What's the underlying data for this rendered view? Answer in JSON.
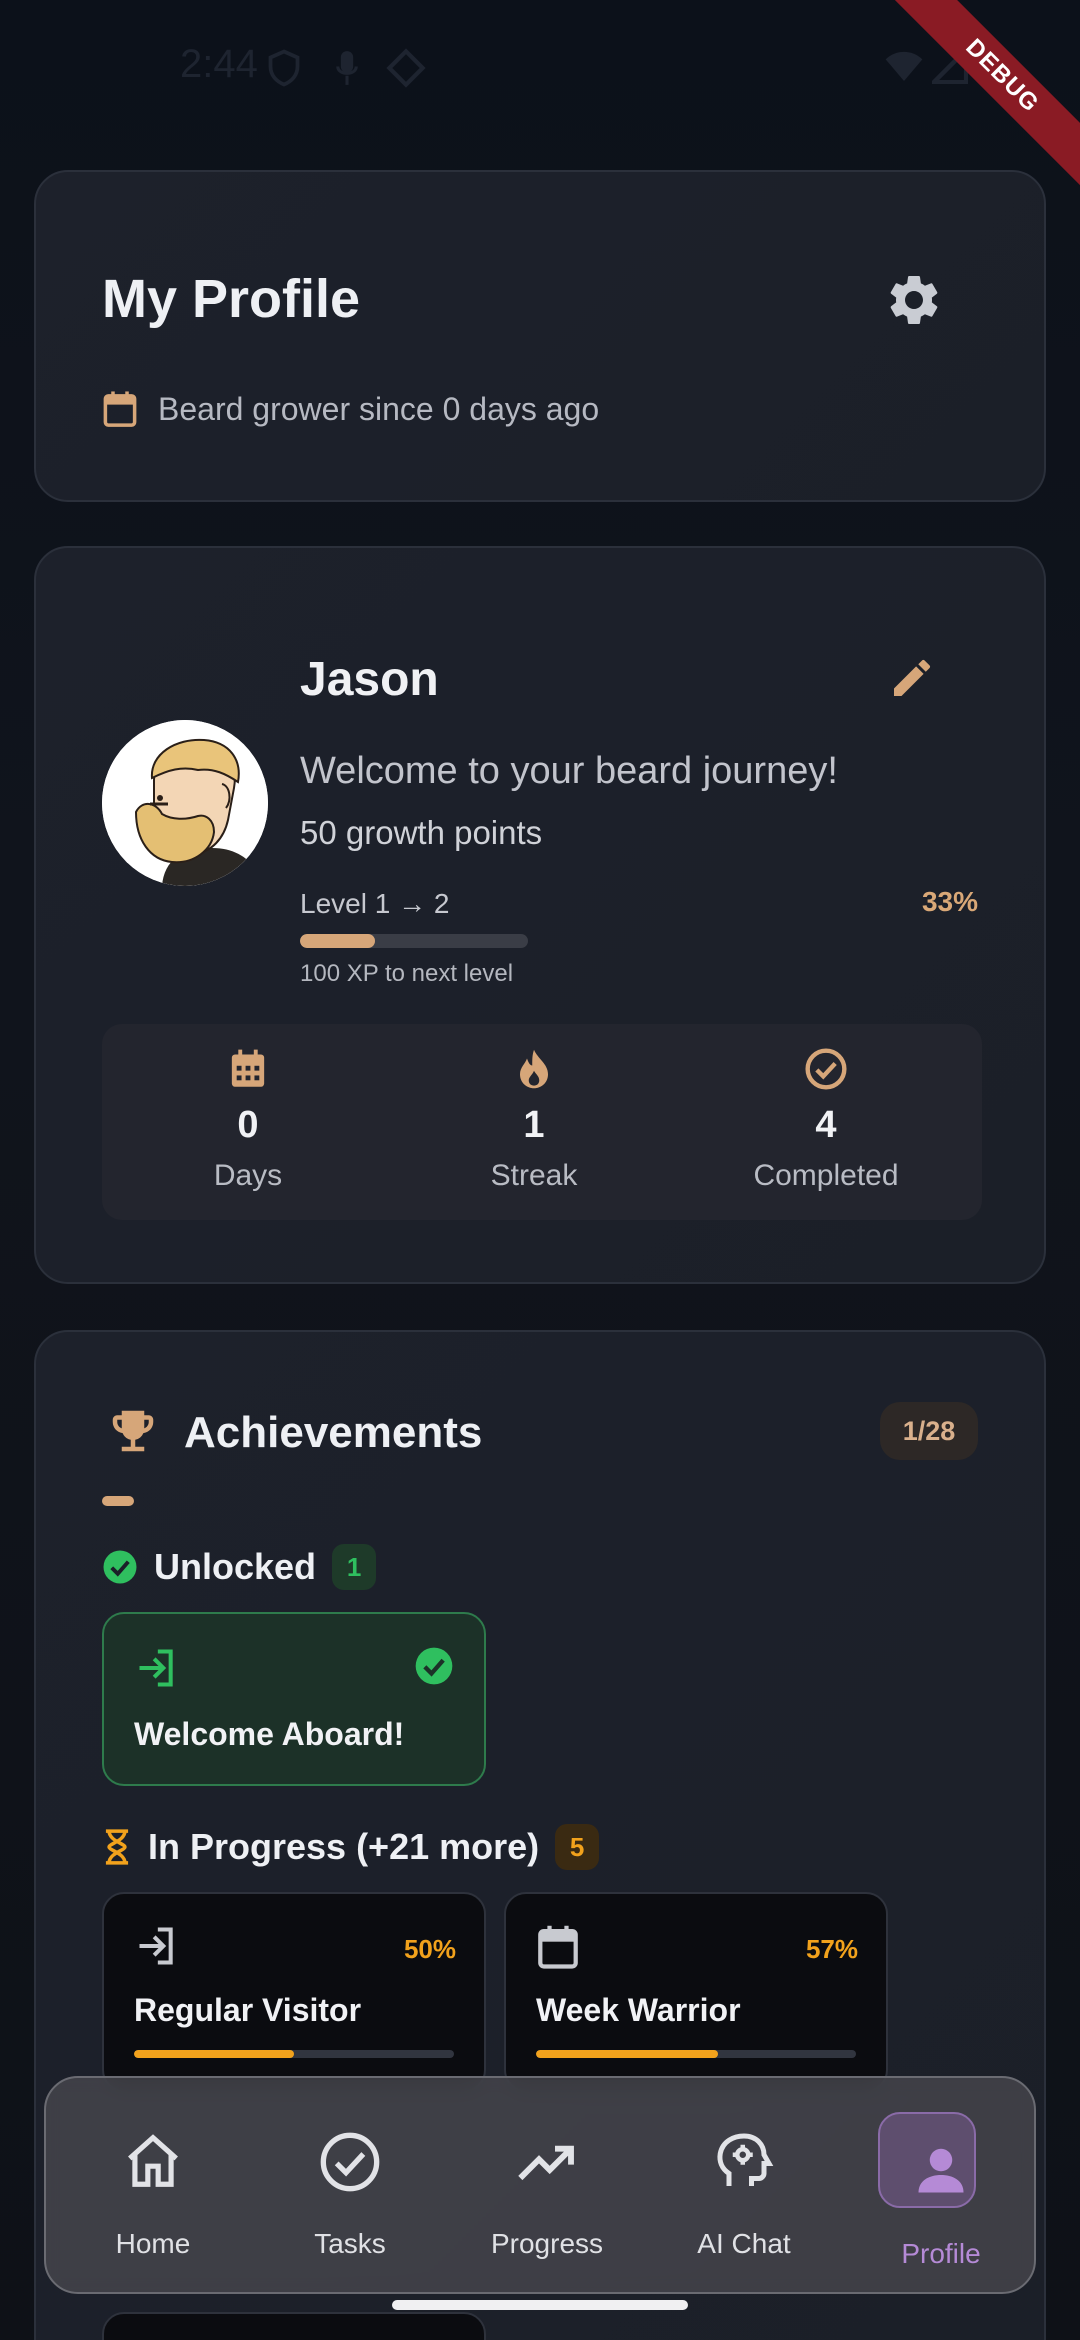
{
  "status_bar": {
    "time": "2:44",
    "debug_label": "DEBUG"
  },
  "profile_header": {
    "title": "My Profile",
    "since_text": "Beard grower since 0 days ago",
    "icons": {
      "settings": "gear-icon",
      "calendar": "calendar-icon"
    }
  },
  "user": {
    "name": "Jason",
    "welcome": "Welcome to your beard journey!",
    "points": "50 growth points",
    "level_text": "Level 1 → 2",
    "level_percent": "33%",
    "xp_progress": 0.33,
    "xp_next": "100 XP to next level",
    "stats": [
      {
        "icon": "calendar-grid-icon",
        "value": "0",
        "label": "Days"
      },
      {
        "icon": "flame-icon",
        "value": "1",
        "label": "Streak"
      },
      {
        "icon": "check-circle-icon",
        "value": "4",
        "label": "Completed"
      }
    ]
  },
  "achievements": {
    "title": "Achievements",
    "count": "1/28",
    "unlocked": {
      "label": "Unlocked",
      "count": "1",
      "items": [
        {
          "name": "Welcome Aboard!",
          "icon": "login-icon"
        }
      ]
    },
    "in_progress": {
      "label": "In Progress (+21 more)",
      "count": "5",
      "items": [
        {
          "name": "Regular Visitor",
          "percent": "50%",
          "progress": 0.5,
          "icon": "login-icon"
        },
        {
          "name": "Week Warrior",
          "percent": "57%",
          "progress": 0.57,
          "icon": "calendar-icon"
        }
      ]
    }
  },
  "nav": {
    "items": [
      {
        "label": "Home",
        "icon": "home-icon"
      },
      {
        "label": "Tasks",
        "icon": "check-circle-icon"
      },
      {
        "label": "Progress",
        "icon": "trending-up-icon"
      },
      {
        "label": "AI Chat",
        "icon": "ai-head-icon"
      },
      {
        "label": "Profile",
        "icon": "person-icon"
      }
    ],
    "active": "Profile"
  },
  "colors": {
    "accent": "#d6a679",
    "success": "#2fbf5f",
    "warning": "#f2a21c",
    "active_nav": "#b58ad6"
  }
}
